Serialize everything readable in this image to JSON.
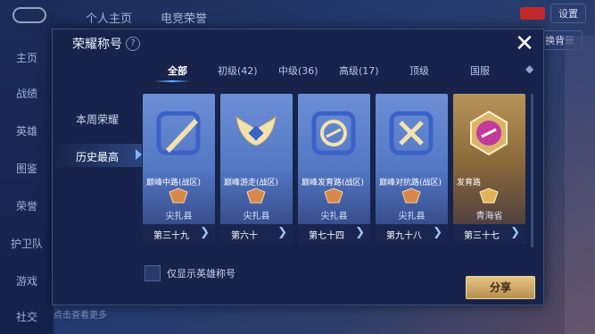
{
  "background": {
    "tabs": [
      "个人主页",
      "电竞荣誉"
    ],
    "sidebar": [
      "主页",
      "战绩",
      "英雄",
      "图鉴",
      "荣誉",
      "护卫队",
      "游戏",
      "社交"
    ],
    "settings_label": "设置",
    "small_button": "换背景",
    "bottom_hint": "点击查看更多"
  },
  "modal": {
    "title": "荣耀称号",
    "help_icon": "?",
    "close_icon": "✕",
    "nav": [
      {
        "label": "本周荣耀"
      },
      {
        "label": "历史最高"
      }
    ],
    "tabs": [
      {
        "label": "全部"
      },
      {
        "label": "初级(42)"
      },
      {
        "label": "中级(36)"
      },
      {
        "label": "高级(17)"
      },
      {
        "label": "顶级"
      },
      {
        "label": "国服"
      }
    ],
    "cards": [
      {
        "title": "巅峰中路(战区)",
        "region": "尖扎县",
        "rank": "第三十九",
        "style": "blue",
        "icon": "slash-icon"
      },
      {
        "title": "巅峰游走(战区)",
        "region": "尖扎县",
        "rank": "第六十",
        "style": "blue",
        "icon": "wings-icon"
      },
      {
        "title": "巅峰发育路(战区)",
        "region": "尖扎县",
        "rank": "第七十四",
        "style": "blue",
        "icon": "target-icon"
      },
      {
        "title": "巅峰对抗路(战区)",
        "region": "尖扎县",
        "rank": "第九十八",
        "style": "blue",
        "icon": "cross-icon"
      },
      {
        "title": "发育路",
        "region": "青海省",
        "rank": "第三十七",
        "style": "gold",
        "icon": "gold-medal-icon"
      }
    ],
    "checkbox_label": "仅显示英雄称号",
    "share_label": "分享"
  }
}
